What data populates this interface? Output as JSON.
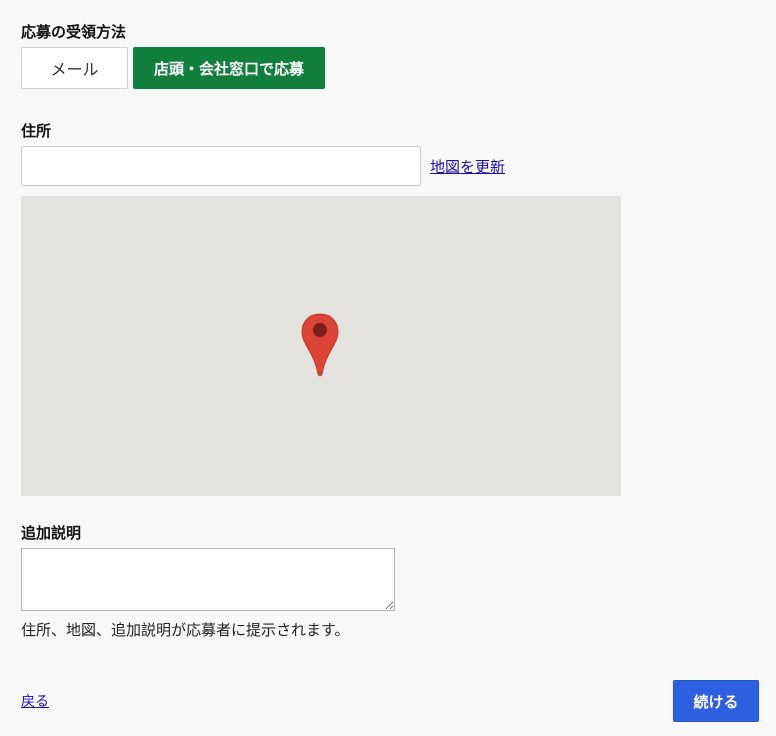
{
  "receive_method": {
    "label": "応募の受領方法",
    "options": [
      {
        "label": "メール",
        "selected": false
      },
      {
        "label": "店頭・会社窓口で応募",
        "selected": true
      }
    ]
  },
  "address": {
    "label": "住所",
    "value": "",
    "placeholder": "",
    "update_map_link": "地図を更新"
  },
  "map": {
    "pin_color": "#db4437",
    "pin_center_color": "#7a1f18",
    "background_color": "#e5e3df"
  },
  "additional_description": {
    "label": "追加説明",
    "value": "",
    "note": "住所、地図、追加説明が応募者に提示されます。"
  },
  "footer": {
    "back_link": "戻る",
    "continue_button": "続ける"
  },
  "colors": {
    "selected_green": "#137f3c",
    "primary_blue": "#2d5fe0",
    "link_blue": "#1a0dab"
  },
  "icons": {
    "map_pin": "map-pin-icon"
  }
}
